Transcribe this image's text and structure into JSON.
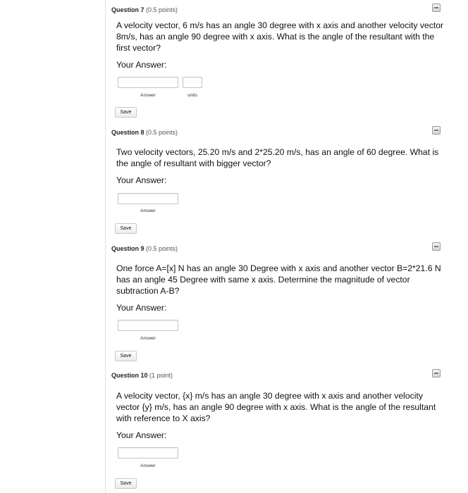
{
  "questions": [
    {
      "title": "Question 7",
      "points": "(0.5 points)",
      "text": "A velocity vector, 6 m/s has an angle 30 degree with x axis and another velocity vector 8m/s, has an angle 90 degree with x axis. What is the angle of the resultant with the first vector?",
      "answer_prompt": "Your Answer:",
      "answer_label": "Answer",
      "units_label": "units",
      "save_label": "Save"
    },
    {
      "title": "Question 8",
      "points": "(0.5 points)",
      "text": "Two velocity vectors, 25.20 m/s and 2*25.20 m/s, has an angle of 60 degree. What is the angle of resultant with bigger vector?",
      "answer_prompt": "Your Answer:",
      "answer_label": "Answer",
      "save_label": "Save"
    },
    {
      "title": "Question 9",
      "points": "(0.5 points)",
      "text": "One force A=[x] N has an angle 30 Degree with x axis and another vector B=2*21.6 N has an angle 45 Degree with same x axis. Determine the magnitude of vector subtraction A-B?",
      "answer_prompt": "Your Answer:",
      "answer_label": "Answer",
      "save_label": "Save"
    },
    {
      "title": "Question 10",
      "points": "(1 point)",
      "text": "A velocity vector, {x} m/s has an angle 30 degree with x axis and another velocity vector {y} m/s, has an angle 90 degree with x axis. What is the angle of the resultant with reference to X axis?",
      "answer_prompt": "Your Answer:",
      "answer_label": "Answer",
      "save_label": "Save"
    }
  ]
}
